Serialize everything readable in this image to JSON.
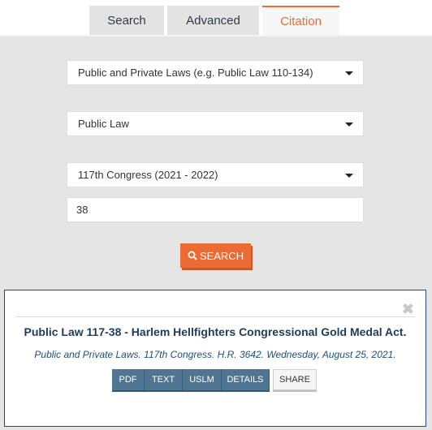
{
  "tabs": [
    {
      "label": "Search"
    },
    {
      "label": "Advanced"
    },
    {
      "label": "Citation"
    }
  ],
  "form": {
    "collection_select": "Public and Private Laws (e.g. Public Law 110-134)",
    "law_type_select": "Public Law",
    "congress_select": "117th Congress (2021 - 2022)",
    "number_value": "38",
    "search_label": "SEARCH"
  },
  "result": {
    "title": "Public Law 117-38 - Harlem Hellfighters Congressional Gold Medal Act.",
    "subtitle": "Public and Private Laws. 117th Congress. H.R. 3642. Wednesday, August 25, 2021.",
    "buttons": {
      "pdf": "PDF",
      "text": "TEXT",
      "uslm": "USLM",
      "details": "DETAILS",
      "share": "SHARE"
    },
    "close_glyph": "✖"
  },
  "colors": {
    "accent": "#ec6a34",
    "navy": "#1d3c5c",
    "button_blue": "#4f7593"
  }
}
